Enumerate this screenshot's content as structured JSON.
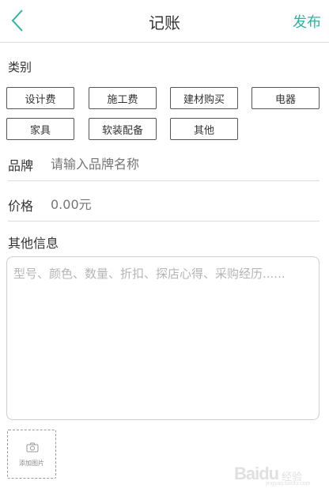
{
  "header": {
    "title": "记账",
    "publish_label": "发布",
    "accent_color": "#2bb3a3"
  },
  "category": {
    "label": "类别",
    "items": [
      "设计费",
      "施工费",
      "建材购买",
      "电器",
      "家具",
      "软装配备",
      "其他"
    ]
  },
  "brand": {
    "label": "品牌",
    "placeholder": "请输入品牌名称"
  },
  "price": {
    "label": "价格",
    "placeholder": "0.00元"
  },
  "other_info": {
    "label": "其他信息",
    "placeholder": "型号、颜色、数量、折扣、探店心得、采购经历......"
  },
  "photo": {
    "add_label": "添加图片"
  },
  "watermark": {
    "text": "Baidu",
    "cn": "经验",
    "url": "jingyan.baidu.com"
  }
}
